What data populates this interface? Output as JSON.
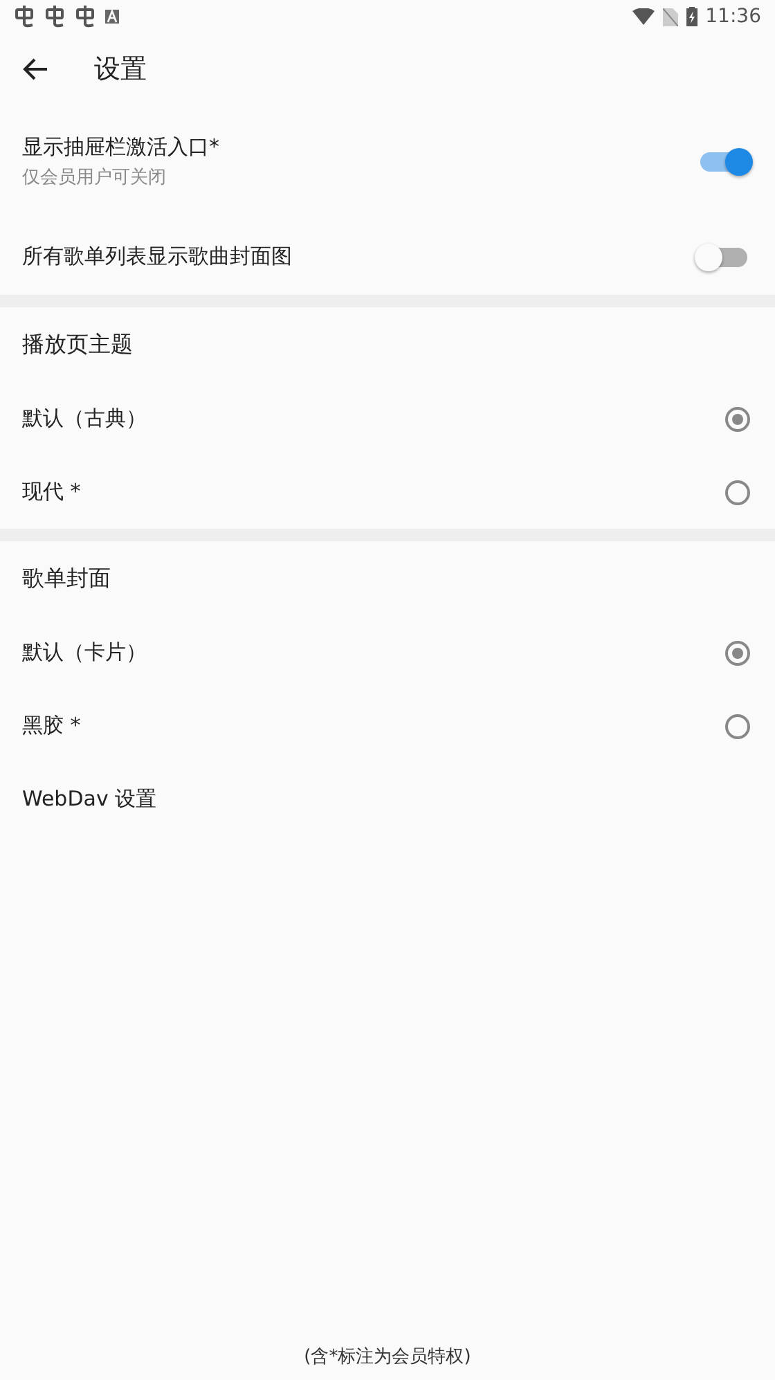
{
  "status_bar": {
    "time": "11:36"
  },
  "toolbar": {
    "title": "设置"
  },
  "switches": [
    {
      "label": "显示抽屉栏激活入口*",
      "subtitle": "仅会员用户可关闭",
      "on": true
    },
    {
      "label": "所有歌单列表显示歌曲封面图",
      "on": false
    }
  ],
  "sections": [
    {
      "title": "播放页主题",
      "options": [
        {
          "label": "默认（古典）",
          "selected": true
        },
        {
          "label": "现代 *",
          "selected": false
        }
      ]
    },
    {
      "title": "歌单封面",
      "options": [
        {
          "label": "默认（卡片）",
          "selected": true
        },
        {
          "label": "黑胶 *",
          "selected": false
        }
      ]
    }
  ],
  "links": [
    {
      "label": "WebDav 设置"
    }
  ],
  "footer": "(含*标注为会员特权)"
}
